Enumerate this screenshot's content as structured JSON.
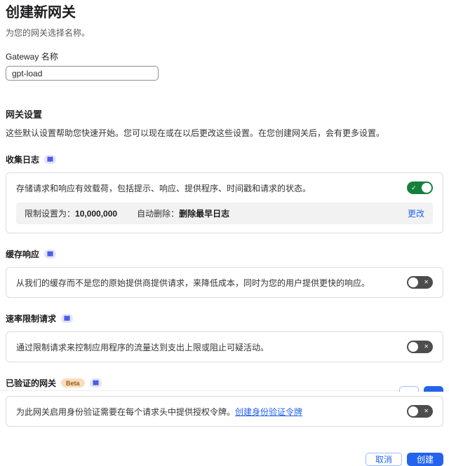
{
  "page": {
    "title": "创建新网关",
    "subtitle": "为您的网关选择名称。"
  },
  "gateway_name": {
    "label": "Gateway 名称",
    "value": "gpt-load"
  },
  "settings": {
    "title": "网关设置",
    "description": "这些默认设置帮助您快速开始。您可以现在或在以后更改这些设置。在您创建网关后，会有更多设置。"
  },
  "sections": [
    {
      "title": "收集日志",
      "description": "存储请求和响应有效载荷，包括提示、响应、提供程序、时间戳和请求的状态。",
      "toggle_state": "on",
      "limits": {
        "limit_label": "限制设置为：",
        "limit_value": "10,000,000",
        "delete_label": "自动删除：",
        "delete_value": "删除最早日志",
        "change_link": "更改"
      }
    },
    {
      "title": "缓存响应",
      "description": "从我们的缓存而不是您的原始提供商提供请求，来降低成本，同时为您的用户提供更快的响应。",
      "toggle_state": "off"
    },
    {
      "title": "速率限制请求",
      "description": "通过限制请求来控制应用程序的流量达到支出上限或阻止可疑活动。",
      "toggle_state": "off"
    },
    {
      "title": "已验证的网关",
      "badge": "Beta",
      "description": "为此网关启用身份验证需要在每个请求头中提供授权令牌。",
      "link_text": "创建身份验证令牌",
      "toggle_state": "off"
    }
  ],
  "icons": {
    "check": "✓",
    "cross": "✕",
    "docs": "book-icon"
  },
  "footer": {
    "cancel": "取消",
    "create": "创建"
  },
  "colors": {
    "accent_blue": "#2463eb",
    "toggle_on_green": "#15803d",
    "toggle_off_gray": "#4d4d4d",
    "beta_badge_bg": "#f9ddbe",
    "beta_badge_text": "#9a5b13",
    "docs_chip_bg": "#e4e7fb",
    "limits_row_bg": "#f2f2f2"
  }
}
